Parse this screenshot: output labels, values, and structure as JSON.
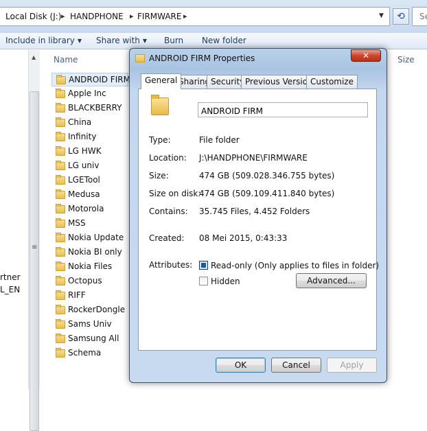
{
  "explorer": {
    "breadcrumbs": [
      "Local Disk (J:)",
      "HANDPHONE",
      "FIRMWARE"
    ],
    "search_placeholder": "Se",
    "toolbar": {
      "include_in_library": "Include in library",
      "share_with": "Share with",
      "burn": "Burn",
      "new_folder": "New folder"
    },
    "columns": {
      "name": "Name",
      "size": "Size"
    },
    "nav_fragments": [
      "rtner",
      "L_EN"
    ],
    "folders": [
      "ANDROID FIRM",
      "Apple Inc",
      "BLACKBERRY",
      "China",
      "Infinity",
      "LG HWK",
      "LG univ",
      "LGETool",
      "Medusa",
      "Motorola",
      "MSS",
      "Nokia  Update",
      "Nokia BI only",
      "Nokia Files",
      "Octopus",
      "RIFF",
      "RockerDongle",
      "Sams Univ",
      "Samsung All",
      "Schema"
    ],
    "selected_folder": "ANDROID FIRM"
  },
  "dialog": {
    "title": "ANDROID FIRM Properties",
    "close_label": "✕",
    "tabs": [
      "General",
      "Sharing",
      "Security",
      "Previous Versions",
      "Customize"
    ],
    "active_tab": "General",
    "folder_name": "ANDROID FIRM",
    "properties": {
      "type_label": "Type:",
      "type_value": "File folder",
      "location_label": "Location:",
      "location_value": "J:\\HANDPHONE\\FIRMWARE",
      "size_label": "Size:",
      "size_value": "474 GB (509.028.346.755 bytes)",
      "size_on_disk_label": "Size on disk:",
      "size_on_disk_value": "474 GB (509.109.411.840 bytes)",
      "contains_label": "Contains:",
      "contains_value": "35.745 Files, 4.452 Folders",
      "created_label": "Created:",
      "created_value": "08 Mei 2015, 0:43:33"
    },
    "attributes": {
      "label": "Attributes:",
      "readonly_label": "Read-only (Only applies to files in folder)",
      "readonly_state": "indeterminate",
      "hidden_label": "Hidden",
      "hidden_checked": false,
      "advanced_button": "Advanced..."
    },
    "buttons": {
      "ok": "OK",
      "cancel": "Cancel",
      "apply": "Apply"
    }
  }
}
